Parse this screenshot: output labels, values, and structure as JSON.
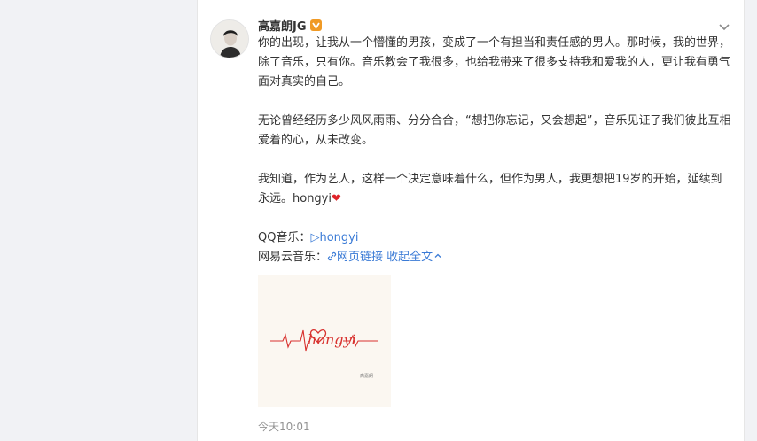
{
  "post": {
    "author_name": "高嘉朗JG",
    "paragraphs": [
      "你的出现，让我从一个懵懂的男孩，变成了一个有担当和责任感的男人。那时候，我的世界，除了音乐，只有你。音乐教会了我很多，也给我带来了很多支持我和爱我的人，更让我有勇气面对真实的自己。",
      "无论曾经经历多少风风雨雨、分分合合，“想把你忘记，又会想起”，音乐见证了我们彼此互相爱着的心，从未改变。",
      "我知道，作为艺人，这样一个决定意味着什么，但作为男人，我更想把19岁的开始，延续到永远。hongyi"
    ],
    "heart_emoji": "❤",
    "qq_music_label": "QQ音乐：",
    "qq_music_link": "▷hongyi",
    "netease_label": "网易云音乐：",
    "netease_link": "网页链接",
    "collapse_label": "收起全文",
    "cover_handwriting": "hongyi",
    "cover_caption": "高嘉朗",
    "timestamp": "今天10:01"
  },
  "colors": {
    "link": "#3b7bd6",
    "heart": "#e0242a",
    "verified_badge": "#f09a25"
  },
  "icons": {
    "verified": "verified-badge-icon",
    "menu": "chevron-down-icon",
    "link": "link-icon",
    "collapse": "chevron-up-icon"
  }
}
